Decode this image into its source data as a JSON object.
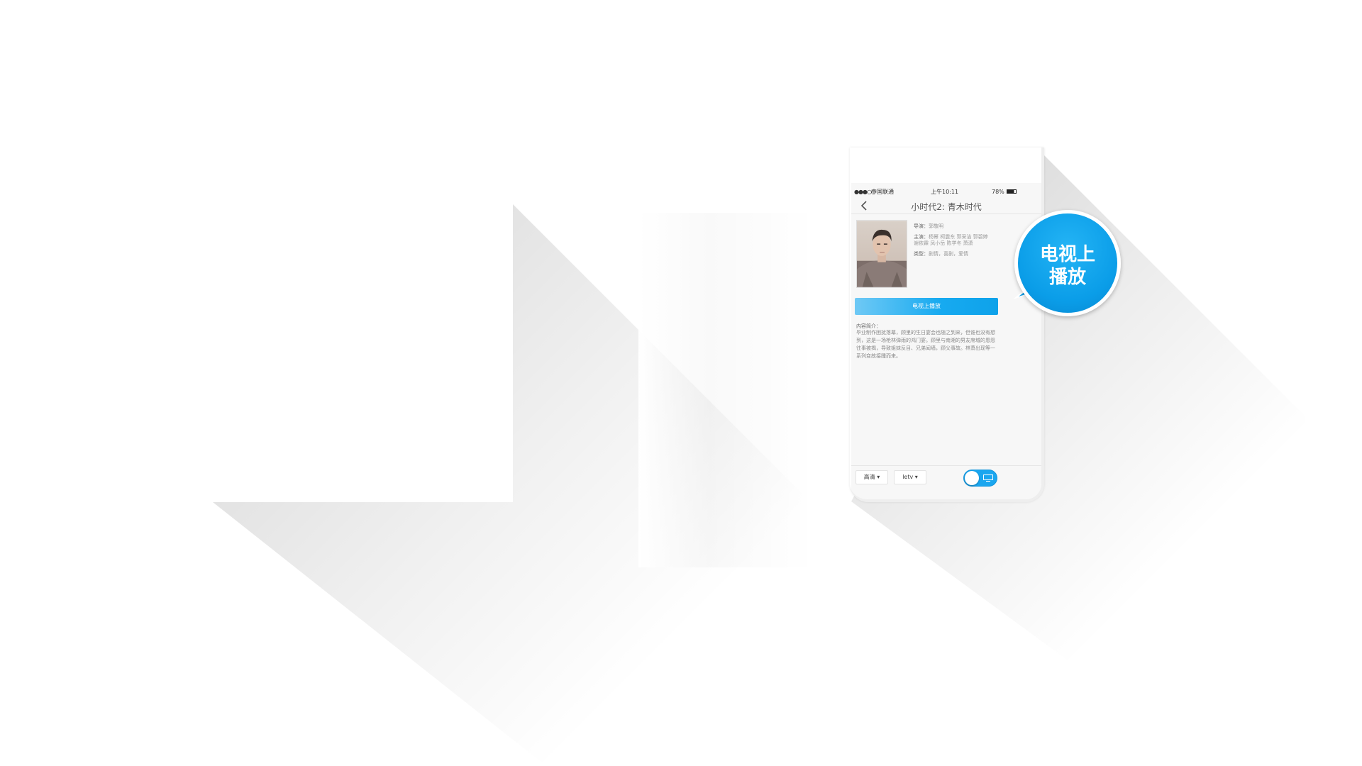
{
  "status_bar": {
    "signal": "●●●○○",
    "carrier": "中国联通",
    "time": "上午10:11",
    "battery": "78%"
  },
  "nav": {
    "back_icon": "chevron-left-icon",
    "title": "小时代2: 青木时代"
  },
  "movie": {
    "director_label": "导演：",
    "director": "郭敬明",
    "cast_label": "主演：",
    "cast_line1": "杨幂 柯震东 郭采洁 郭碧婷",
    "cast_line2": "谢依霖 凤小岳 陈学冬 萧潇",
    "genre_label": "类型：",
    "genre": "剧情，喜剧，爱情"
  },
  "play_tv_button": "电视上播放",
  "synopsis": {
    "label": "内容简介：",
    "text": "毕业制作困扰落幕，顾里的生日宴会也随之到来，但谁也没有想到，这是一场枪林弹雨的鸿门宴。顾里与南湘的男友席城的恩怨往事被揭，导致姐妹反目、兄弟闻墙，顾父事故。林萧出现等一系列变故接踵而来。"
  },
  "bottom_bar": {
    "quality": "高清 ▾",
    "source": "letv ▾",
    "toggle_icon": "tv-icon"
  },
  "bubble": {
    "line1": "电视上",
    "line2": "播放"
  },
  "colors": {
    "accent": "#0ea2ea",
    "bubble": "#0a9de8"
  }
}
